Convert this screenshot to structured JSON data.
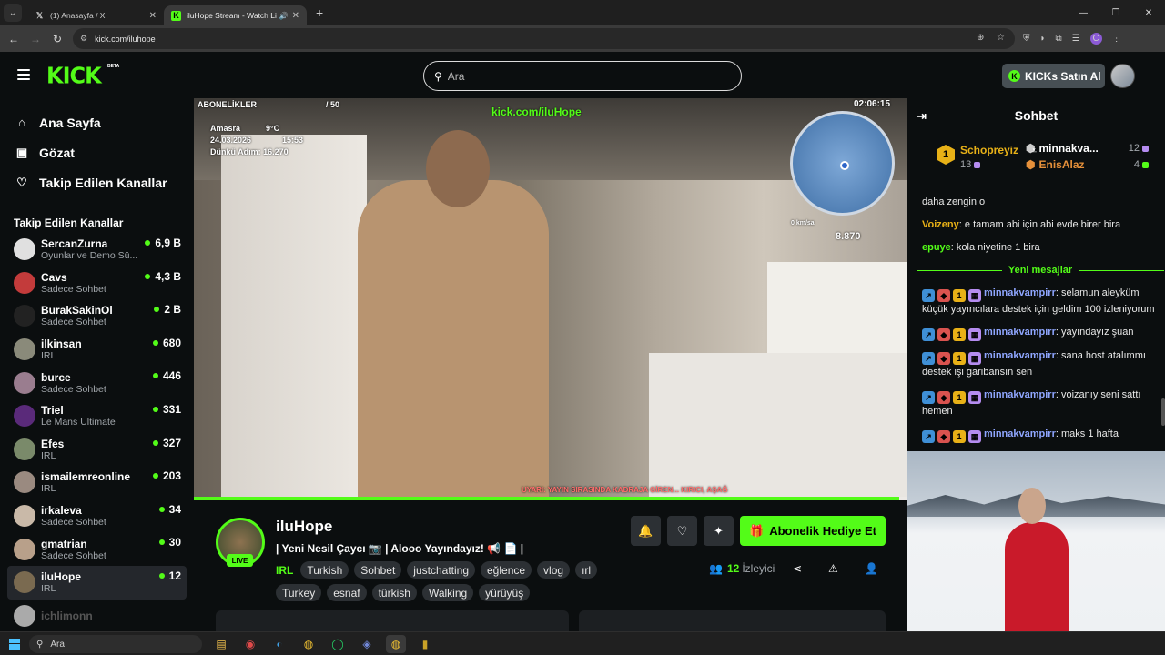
{
  "browser": {
    "tabs": [
      {
        "title": "(1) Anasayfa / X",
        "favicon": "x-logo-icon"
      },
      {
        "title": "iluHope Stream - Watch Live",
        "favicon": "kick-logo-icon"
      }
    ],
    "url": "kick.com/iluhope"
  },
  "header": {
    "logo": "KICK",
    "beta": "BETA",
    "search_placeholder": "Ara",
    "kicks_button": "KICKs Satın Al"
  },
  "sidebar": {
    "nav": [
      {
        "label": "Ana Sayfa",
        "icon": "home-icon"
      },
      {
        "label": "Gözat",
        "icon": "browse-icon"
      },
      {
        "label": "Takip Edilen Kanallar",
        "icon": "heart-icon"
      }
    ],
    "section_title": "Takip Edilen Kanallar",
    "channels": [
      {
        "name": "SercanZurna",
        "category": "Oyunlar ve Demo Sü...",
        "viewers": "6,9 B",
        "color": "#e0e0e0"
      },
      {
        "name": "Cavs",
        "category": "Sadece Sohbet",
        "viewers": "4,3 B",
        "color": "#c33b3b"
      },
      {
        "name": "BurakSakinOl",
        "category": "Sadece Sohbet",
        "viewers": "2 B",
        "color": "#222222"
      },
      {
        "name": "ilkinsan",
        "category": "IRL",
        "viewers": "680",
        "color": "#8a8a7a"
      },
      {
        "name": "burce",
        "category": "Sadece Sohbet",
        "viewers": "446",
        "color": "#9a7d8f"
      },
      {
        "name": "Triel",
        "category": "Le Mans Ultimate",
        "viewers": "331",
        "color": "#5a2a7a"
      },
      {
        "name": "Efes",
        "category": "IRL",
        "viewers": "327",
        "color": "#7a8a6a"
      },
      {
        "name": "ismailemreonline",
        "category": "IRL",
        "viewers": "203",
        "color": "#9a8a80"
      },
      {
        "name": "irkaleva",
        "category": "Sadece Sohbet",
        "viewers": "34",
        "color": "#c9b9a8"
      },
      {
        "name": "gmatrian",
        "category": "Sadece Sohbet",
        "viewers": "30",
        "color": "#b8a08a"
      },
      {
        "name": "iluHope",
        "category": "IRL",
        "viewers": "12",
        "color": "#7a6a50",
        "active": true
      },
      {
        "name": "ichlimonn",
        "category": "",
        "viewers": "",
        "color": "#aaaaaa"
      }
    ]
  },
  "video": {
    "watermark": "kick.com/iluHope",
    "time": "02:06:15",
    "subs_label": "ABONELİKLER",
    "subs_count": "/ 50",
    "city": "Amasra",
    "temp": "9°C",
    "date": "24.03.2026",
    "clock": "15:53",
    "steps": "Dünkü Adım: 16.270",
    "speed": "8.870",
    "speed_unit": "0 km/sa",
    "ticker": "UYARI: YAYIN SIRASINDA KADRAJA GİREN... KIRICI, AŞAĞ",
    "progress": 0.99
  },
  "stream": {
    "name": "iluHope",
    "live": "LIVE",
    "title": "| Yeni Nesil Çaycı 📷 | Alooo Yayındayız! 📢 📄 |",
    "category": "IRL",
    "tags": [
      "Turkish",
      "Sohbet",
      "justchatting",
      "eğlence",
      "vlog",
      "ırl",
      "Turkey",
      "esnaf",
      "türkish",
      "Walking",
      "yürüyüş"
    ],
    "subscribe_button": "Abonelik Hediye Et",
    "viewer_count": "12",
    "viewer_label": "İzleyici"
  },
  "chat": {
    "title": "Sohbet",
    "top_gifters": [
      {
        "rank": "1",
        "name": "Schopreyiz",
        "count": "13"
      },
      {
        "name": "minnakva...",
        "count": "12"
      },
      {
        "name": "EnisAlaz",
        "count": "4"
      }
    ],
    "messages": [
      {
        "user": "",
        "text": "daha zengin o",
        "color": "#e9e9e9"
      },
      {
        "user": "Voizeny",
        "text": "e tamam abi için abi evde birer bira",
        "color": "#e8b117"
      },
      {
        "user": "epuye",
        "text": "kola niyetine 1 bira",
        "color": "#53fc18"
      }
    ],
    "divider": "Yeni mesajlar",
    "new_messages": [
      {
        "user": "minnakvampirr",
        "text": "selamun aleyküm küçük yayıncılara destek için geldim 100 izleniyorum"
      },
      {
        "user": "minnakvampirr",
        "text": "yayındayız şuan"
      },
      {
        "user": "minnakvampirr",
        "text": "sana host atalımmı destek işi garibansın sen"
      },
      {
        "user": "minnakvampirr",
        "text": "voizanıy seni sattı hemen"
      },
      {
        "user": "minnakvampirr",
        "text": "maks 1 hafta"
      }
    ],
    "username_color": "#8fa6ff"
  },
  "taskbar": {
    "search": "Ara"
  }
}
